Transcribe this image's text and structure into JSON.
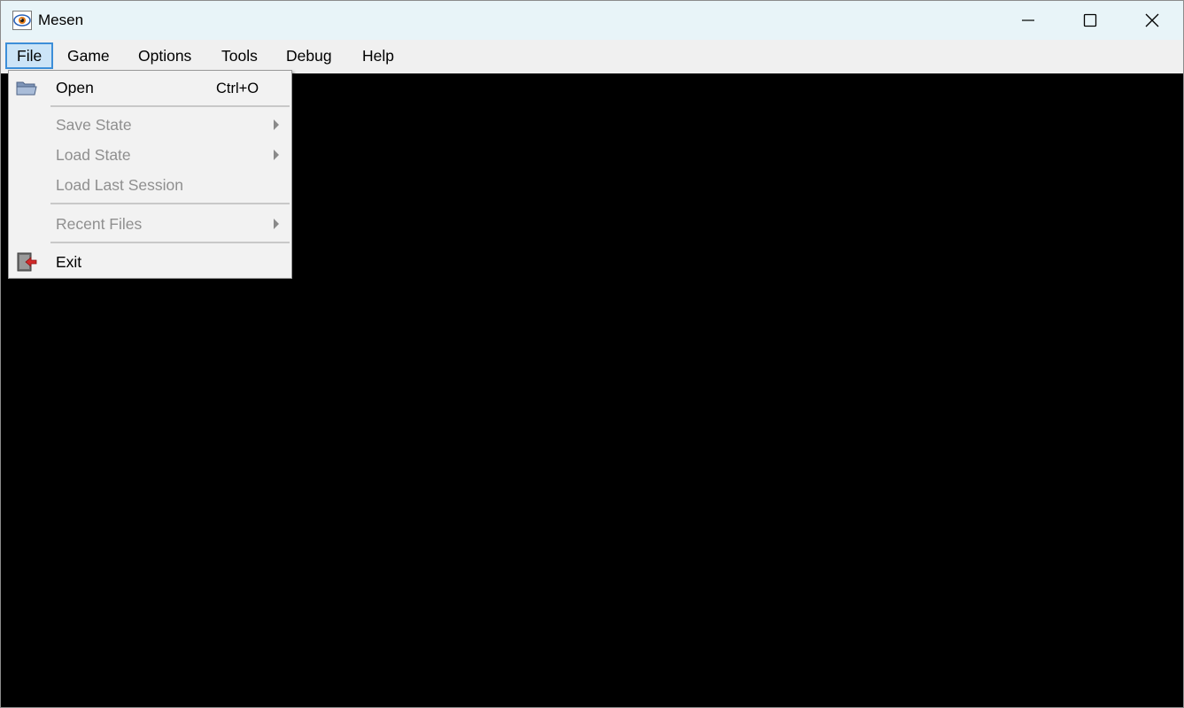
{
  "window": {
    "title": "Mesen",
    "app_icon": "mesen-eye-icon"
  },
  "caption_buttons": {
    "minimize_icon": "minimize-icon",
    "maximize_icon": "maximize-icon",
    "close_icon": "close-icon"
  },
  "menubar": {
    "items": [
      {
        "label": "File",
        "active": true
      },
      {
        "label": "Game"
      },
      {
        "label": "Options"
      },
      {
        "label": "Tools"
      },
      {
        "label": "Debug"
      },
      {
        "label": "Help"
      }
    ]
  },
  "file_menu": {
    "items": [
      {
        "label": "Open",
        "shortcut": "Ctrl+O",
        "icon": "folder-open-icon",
        "enabled": true
      },
      {
        "label": "Save State",
        "submenu": true,
        "enabled": false
      },
      {
        "label": "Load State",
        "submenu": true,
        "enabled": false
      },
      {
        "label": "Load Last Session",
        "enabled": false
      },
      {
        "label": "Recent Files",
        "submenu": true,
        "enabled": false
      },
      {
        "label": "Exit",
        "icon": "exit-door-icon",
        "enabled": true
      }
    ]
  },
  "colors": {
    "titlebar_bg": "#e8f4f8",
    "menubar_bg": "#f0f0f0",
    "active_menu_bg": "#cce4f7",
    "active_menu_border": "#3d8ed8",
    "content_bg": "#000000",
    "disabled_text": "#8f8f8f"
  }
}
